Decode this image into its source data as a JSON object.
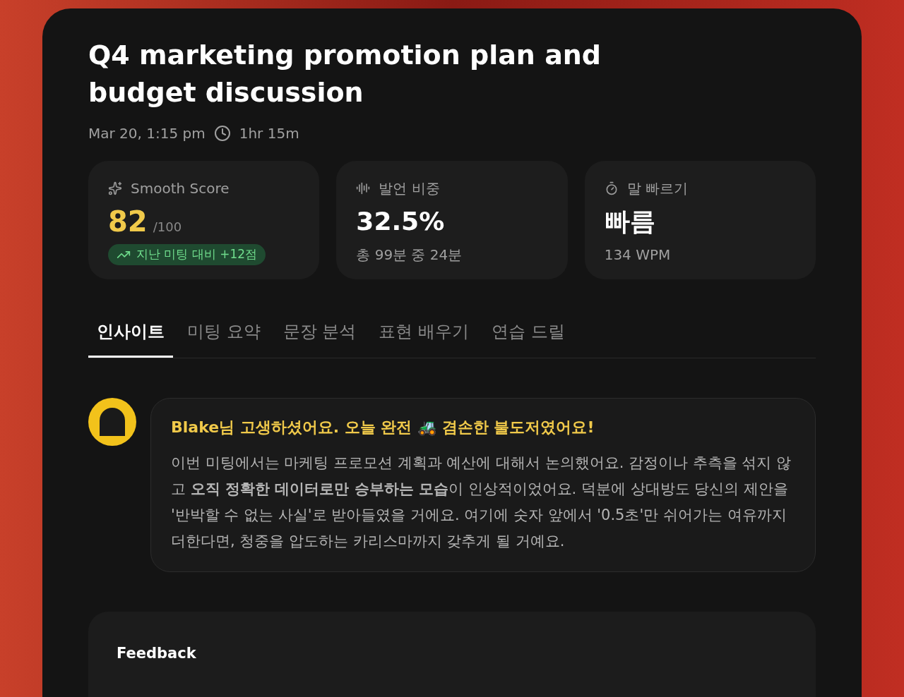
{
  "title": "Q4 marketing promotion plan and budget discussion",
  "meta": {
    "datetime": "Mar 20, 1:15 pm",
    "duration": "1hr 15m"
  },
  "stats": [
    {
      "kind": "score",
      "label": "Smooth Score",
      "value": "82",
      "suffix": "/100",
      "badge": "지난 미팅 대비 +12점"
    },
    {
      "kind": "share",
      "label": "발언 비중",
      "value": "32.5%",
      "detail": "총 99분 중 24분"
    },
    {
      "kind": "speed",
      "label": "말 빠르기",
      "value": "빠름",
      "detail": "134 WPM"
    }
  ],
  "tabs": [
    {
      "label": "인사이트",
      "selected": true
    },
    {
      "label": "미팅 요약",
      "selected": false
    },
    {
      "label": "문장 분석",
      "selected": false
    },
    {
      "label": "표현 배우기",
      "selected": false
    },
    {
      "label": "연습 드릴",
      "selected": false
    }
  ],
  "insight": {
    "headline": "Blake님 고생하셨어요. 오늘 완전 🚜 겸손한 불도저였어요!",
    "body": "이번 미팅에서는 마케팅 프로모션 계획과 예산에 대해서 논의했어요. 감정이나 추측을 섞지 않고 **오직 정확한 데이터로만 승부하는 모습**이 인상적이었어요. 덕분에 상대방도 당신의 제안을 '반박할 수 없는 사실'로 받아들였을 거에요. 여기에 숫자 앞에서 '0.5초'만 쉬어가는 여유까지 더한다면, 청중을 압도하는 카리스마까지 갖추게 될 거예요."
  },
  "feedback": {
    "title": "Feedback"
  }
}
